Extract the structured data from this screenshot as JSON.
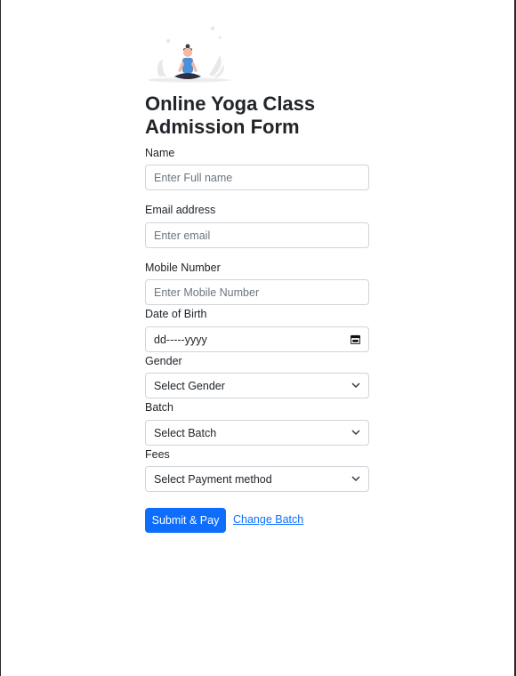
{
  "form": {
    "title": "Online Yoga Class Admission Form",
    "name": {
      "label": "Name",
      "placeholder": "Enter Full name"
    },
    "email": {
      "label": "Email address",
      "placeholder": "Enter email"
    },
    "mobile": {
      "label": "Mobile Number",
      "placeholder": "Enter Mobile Number"
    },
    "dob": {
      "label": "Date of Birth",
      "value": "dd-----yyyy",
      "icon": "calendar-icon"
    },
    "gender": {
      "label": "Gender",
      "selected": "Select Gender",
      "icon": "chevron-down-icon"
    },
    "batch": {
      "label": "Batch",
      "selected": "Select Batch",
      "icon": "chevron-down-icon"
    },
    "fees": {
      "label": "Fees",
      "selected": "Select Payment method",
      "icon": "chevron-down-icon"
    },
    "submit_label": "Submit & Pay",
    "change_batch_label": "Change Batch"
  },
  "colors": {
    "primary": "#0d6efd",
    "border": "#ced4da",
    "text": "#212529",
    "placeholder": "#6c757d"
  }
}
